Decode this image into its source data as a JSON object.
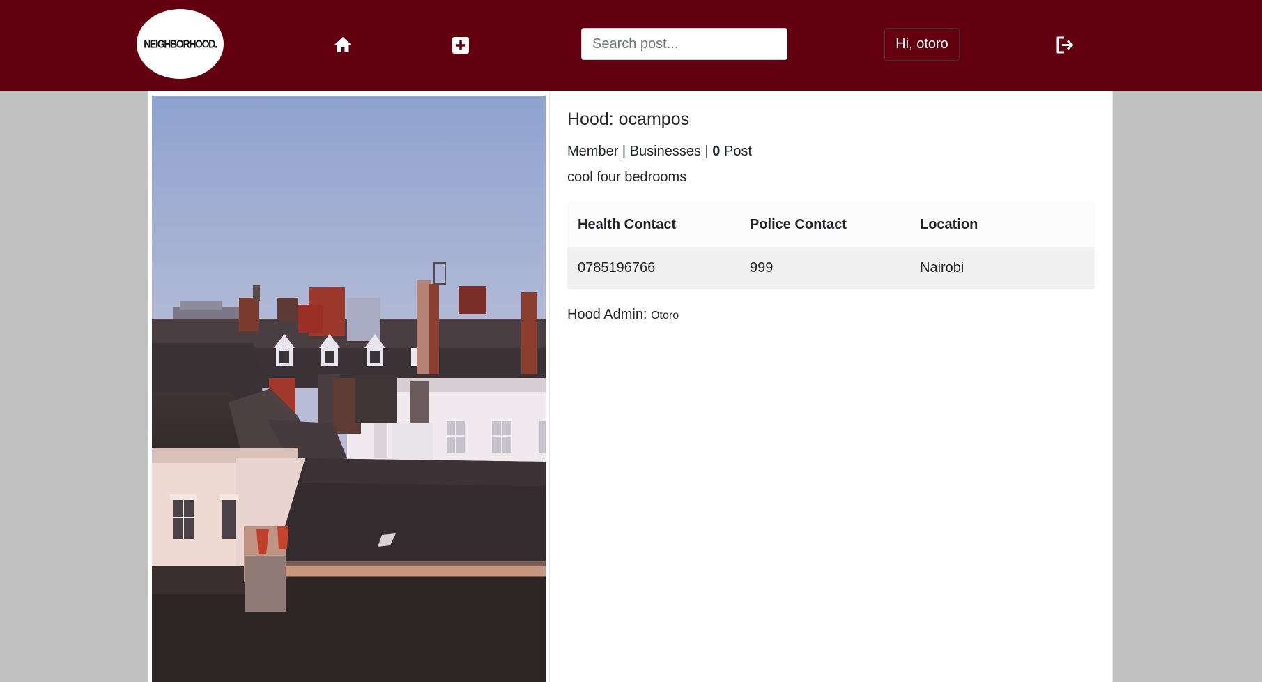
{
  "navbar": {
    "logo_text": "NEIGHBORHOOD.",
    "search_placeholder": "Search post...",
    "greeting": "Hi, otoro",
    "icons": [
      "home-icon",
      "plus-square-icon",
      "logout-icon"
    ]
  },
  "hood": {
    "title": "Hood: ocampos",
    "members_label": "Member",
    "separator": "|",
    "businesses_label": "Businesses",
    "post_count": "0",
    "post_label": "Post",
    "description": "cool four bedrooms",
    "table": {
      "headers": [
        "Health Contact",
        "Police Contact",
        "Location"
      ],
      "row": [
        "0785196766",
        "999",
        "Nairobi"
      ]
    },
    "admin_label": "Hood Admin:",
    "admin_name": "Otoro"
  },
  "colors": {
    "navbar_bg": "#620010",
    "page_bg": "#c1c1c1",
    "card_bg": "#ffffff"
  }
}
